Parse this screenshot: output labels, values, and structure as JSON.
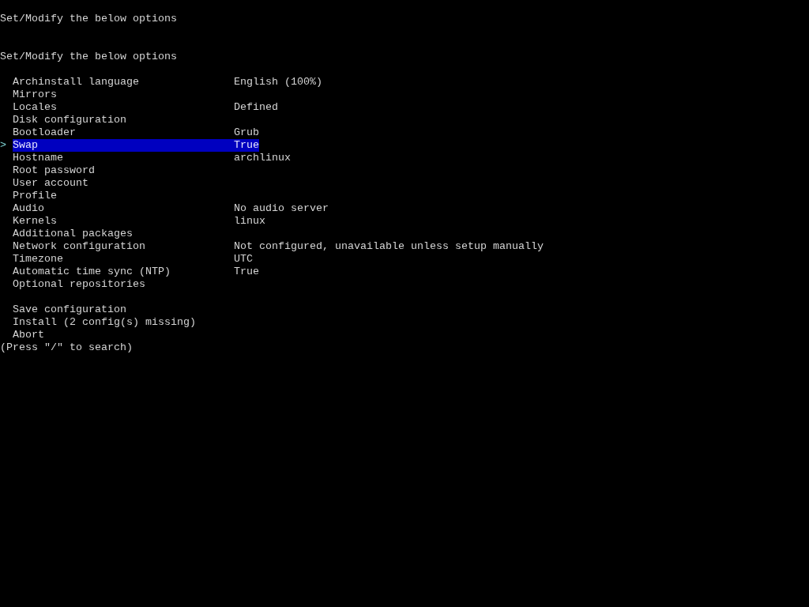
{
  "header": "Set/Modify the below options",
  "title": "Set/Modify the below options",
  "cursor": ">",
  "options": [
    {
      "label": "Archinstall language",
      "value": "English (100%)",
      "selected": false
    },
    {
      "label": "Mirrors",
      "selected": false
    },
    {
      "label": "Locales",
      "value": "Defined",
      "selected": false
    },
    {
      "label": "Disk configuration",
      "selected": false
    },
    {
      "label": "Bootloader",
      "value": "Grub",
      "selected": false
    },
    {
      "label": "Swap",
      "value": "True",
      "selected": true
    },
    {
      "label": "Hostname",
      "value": "archlinux",
      "selected": false
    },
    {
      "label": "Root password",
      "selected": false
    },
    {
      "label": "User account",
      "selected": false
    },
    {
      "label": "Profile",
      "selected": false
    },
    {
      "label": "Audio",
      "value": "No audio server",
      "selected": false
    },
    {
      "label": "Kernels",
      "value": "linux",
      "selected": false
    },
    {
      "label": "Additional packages",
      "selected": false
    },
    {
      "label": "Network configuration",
      "value": "Not configured, unavailable unless setup manually",
      "selected": false
    },
    {
      "label": "Timezone",
      "value": "UTC",
      "selected": false
    },
    {
      "label": "Automatic time sync (NTP)",
      "value": "True",
      "selected": false
    },
    {
      "label": "Optional repositories",
      "selected": false
    }
  ],
  "actions": [
    {
      "label": "Save configuration",
      "selected": false
    },
    {
      "label": "Install (2 config(s) missing)",
      "selected": false
    },
    {
      "label": "Abort",
      "selected": false
    }
  ],
  "hint": "(Press \"/\" to search)"
}
